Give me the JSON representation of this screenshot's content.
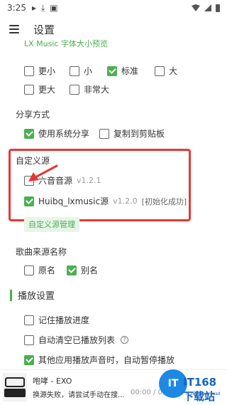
{
  "status_bar": {
    "time": "3:25"
  },
  "header": {
    "title": "设置"
  },
  "font_size_preview": "LX Music 字体大小预览",
  "font_size_options": [
    {
      "label": "更小",
      "checked": false
    },
    {
      "label": "小",
      "checked": false
    },
    {
      "label": "标准",
      "checked": true
    },
    {
      "label": "大",
      "checked": false
    },
    {
      "label": "更大",
      "checked": false
    },
    {
      "label": "非常大",
      "checked": false
    }
  ],
  "share": {
    "label": "分享方式",
    "options": [
      {
        "label": "使用系统分享",
        "checked": true
      },
      {
        "label": "复制到剪贴板",
        "checked": false
      }
    ]
  },
  "custom_source": {
    "label": "自定义源",
    "sources": [
      {
        "name": "六音音源",
        "version": "v1.2.1",
        "status": "",
        "checked": false
      },
      {
        "name": "Huibq_lxmusic源",
        "version": "v1.2.0",
        "status": "[初始化成功]",
        "checked": true
      }
    ],
    "manage_button": "自定义源管理"
  },
  "source_name": {
    "label": "歌曲来源名称",
    "options": [
      {
        "label": "原名",
        "checked": false
      },
      {
        "label": "别名",
        "checked": true
      }
    ]
  },
  "playback": {
    "heading": "播放设置",
    "options": [
      {
        "label": "记住播放进度",
        "checked": false
      },
      {
        "label": "自动清空已播放列表",
        "checked": false
      },
      {
        "label": "其他应用播放声音时，自动暂停播放",
        "checked": true
      }
    ]
  },
  "player": {
    "song": "咆哮 - EXO",
    "message": "换源失败，请尝试手动在搜...",
    "time": "00:00 / 00:00"
  },
  "watermark": {
    "logo": "IT",
    "text": "IT168下载站",
    "sub": "IT168 Download"
  },
  "colors": {
    "accent": "#4caf50",
    "highlight": "#e53935"
  }
}
